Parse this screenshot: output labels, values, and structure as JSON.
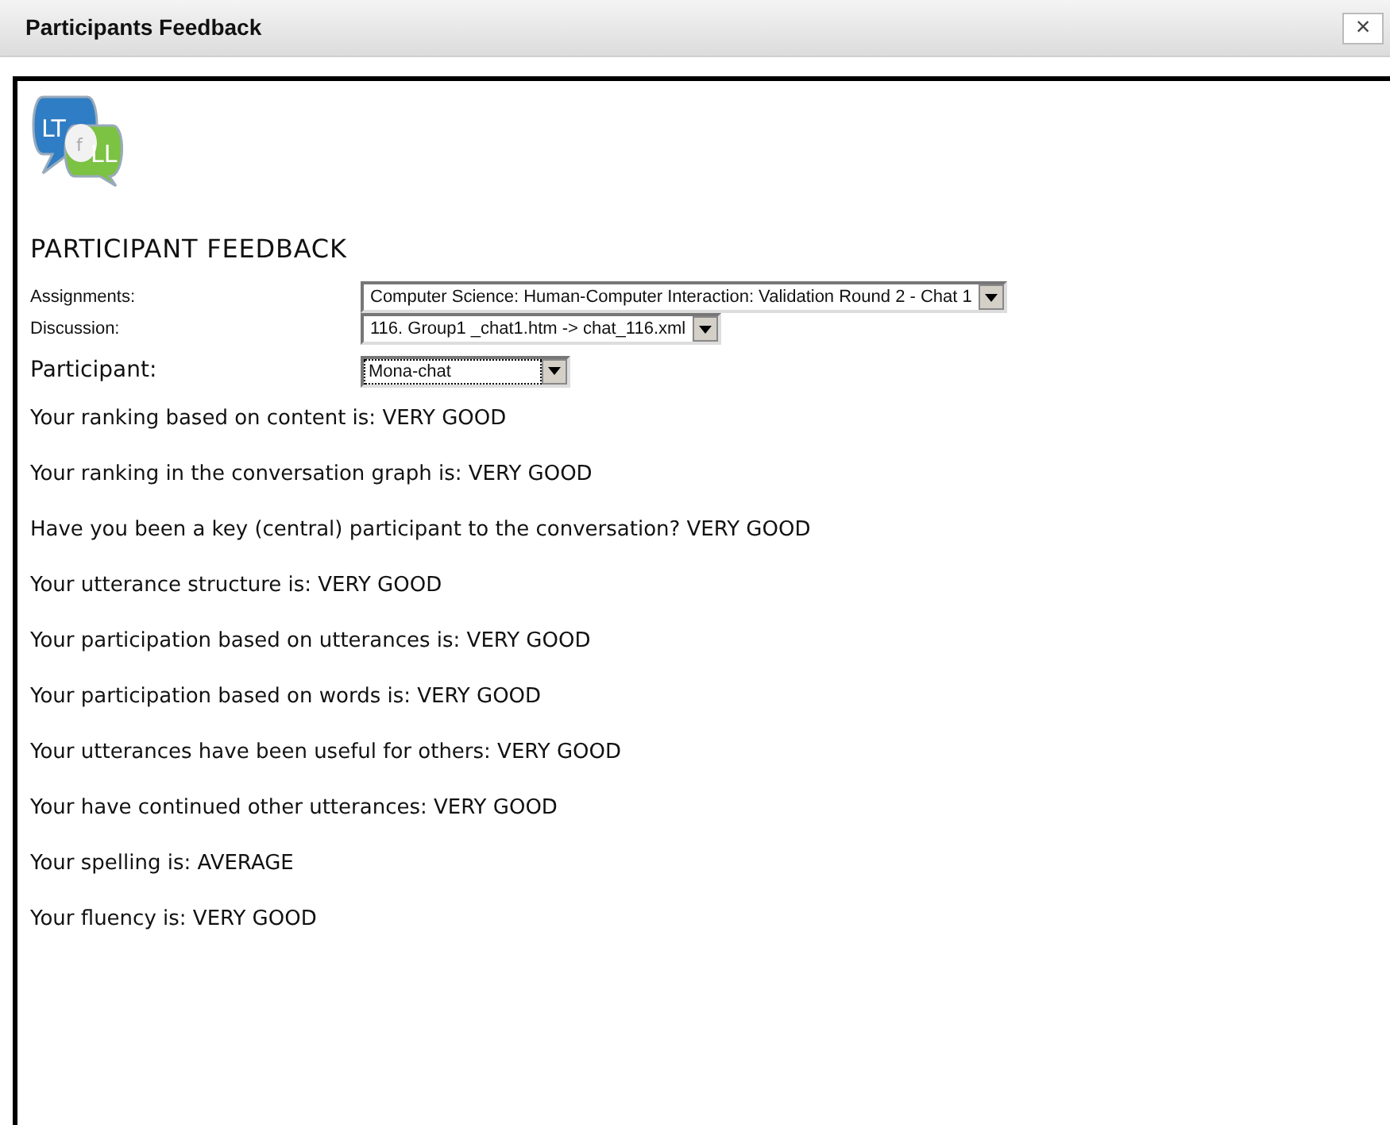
{
  "window": {
    "title": "Participants Feedback",
    "close": "×"
  },
  "logo": {
    "parts": [
      "LT",
      "f",
      "LL"
    ]
  },
  "heading": "PARTICIPANT FEEDBACK",
  "filters": [
    {
      "label": "Assignments:",
      "value": "Computer Science: Human-Computer Interaction: Validation Round 2 - Chat 1",
      "kind": "small"
    },
    {
      "label": "Discussion:",
      "value": "116. Group1 _chat1.htm -> chat_116.xml",
      "kind": "small"
    },
    {
      "label": "Participant:",
      "value": "Mona-chat",
      "kind": "focused"
    }
  ],
  "results": [
    "Your ranking based on content is: VERY GOOD",
    "Your ranking in the conversation graph is: VERY GOOD",
    "Have you been a key (central) participant to the conversation? VERY GOOD",
    "Your utterance structure is: VERY GOOD",
    "Your participation based on utterances is: VERY GOOD",
    "Your participation based on words is: VERY GOOD",
    "Your utterances have been useful for others: VERY GOOD",
    "Your have continued other utterances: VERY GOOD",
    "Your spelling is: AVERAGE",
    "Your fluency is: VERY GOOD"
  ]
}
